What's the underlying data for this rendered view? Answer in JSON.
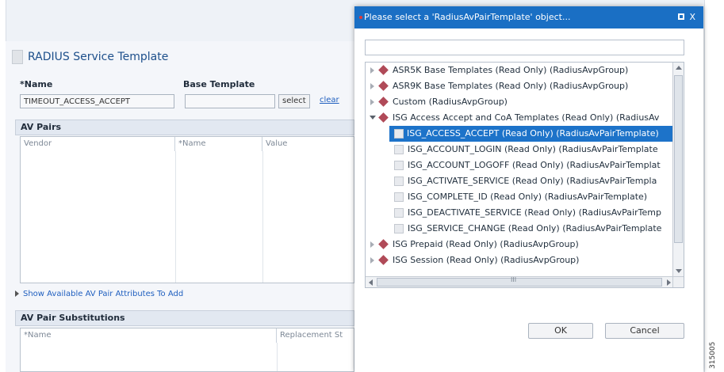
{
  "page": {
    "title": "RADIUS Service Template",
    "name_label": "*Name",
    "name_value": "TIMEOUT_ACCESS_ACCEPT",
    "base_template_label": "Base Template",
    "base_template_value": "",
    "select_label": "select",
    "clear_label": "clear",
    "av_pairs_label": "AV Pairs",
    "av_columns": [
      "Vendor",
      "*Name",
      "Value"
    ],
    "show_link": "Show Available AV Pair Attributes To Add",
    "subst_label": "AV Pair Substitutions",
    "subst_columns": [
      "*Name",
      "Replacement St"
    ]
  },
  "dialog": {
    "title": "Please select a 'RadiusAvPairTemplate' object...",
    "close_label": "X",
    "search_value": "",
    "items": [
      {
        "label": "ASR5K Base Templates (Read Only) (RadiusAvpGroup)"
      },
      {
        "label": "ASR9K Base Templates (Read Only) (RadiusAvpGroup)"
      },
      {
        "label": "Custom (RadiusAvpGroup)"
      },
      {
        "label": "ISG Access Accept and CoA Templates (Read Only) (RadiusAv"
      },
      {
        "label": "ISG_ACCESS_ACCEPT (Read Only) (RadiusAvPairTemplate)"
      },
      {
        "label": "ISG_ACCOUNT_LOGIN (Read Only) (RadiusAvPairTemplate"
      },
      {
        "label": "ISG_ACCOUNT_LOGOFF (Read Only) (RadiusAvPairTemplat"
      },
      {
        "label": "ISG_ACTIVATE_SERVICE (Read Only) (RadiusAvPairTempla"
      },
      {
        "label": "ISG_COMPLETE_ID (Read Only) (RadiusAvPairTemplate)"
      },
      {
        "label": "ISG_DEACTIVATE_SERVICE (Read Only) (RadiusAvPairTemp"
      },
      {
        "label": "ISG_SERVICE_CHANGE (Read Only) (RadiusAvPairTemplate"
      },
      {
        "label": "ISG Prepaid (Read Only) (RadiusAvpGroup)"
      },
      {
        "label": "ISG Session (Read Only) (RadiusAvpGroup)"
      }
    ],
    "hscroll_grip": "III",
    "ok_label": "OK",
    "cancel_label": "Cancel"
  },
  "side_id": "315005",
  "colors": {
    "accent": "#1a6fc4",
    "selection": "#1d73c9",
    "group_icon": "#b04a58",
    "link": "#1f5fbf"
  }
}
